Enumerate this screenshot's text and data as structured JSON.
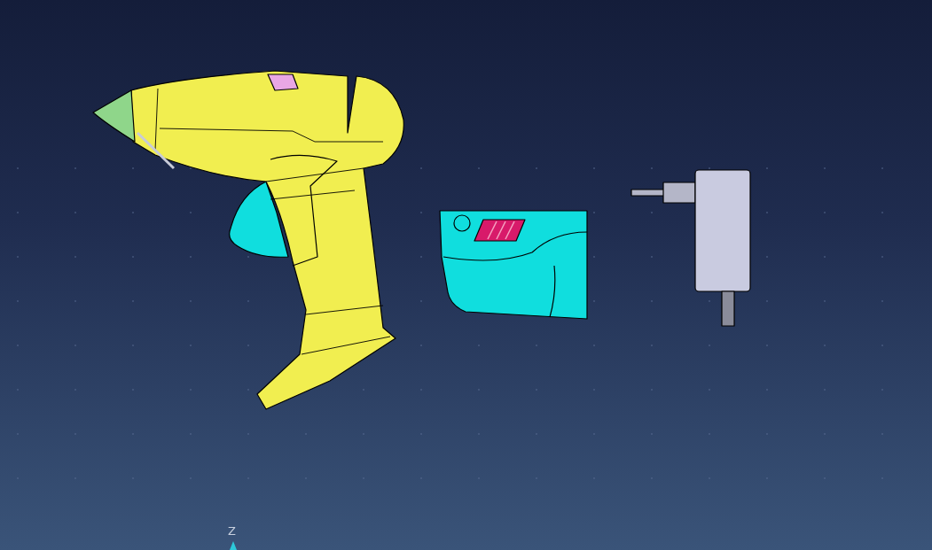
{
  "viewport": {
    "axis_label": "Z"
  }
}
